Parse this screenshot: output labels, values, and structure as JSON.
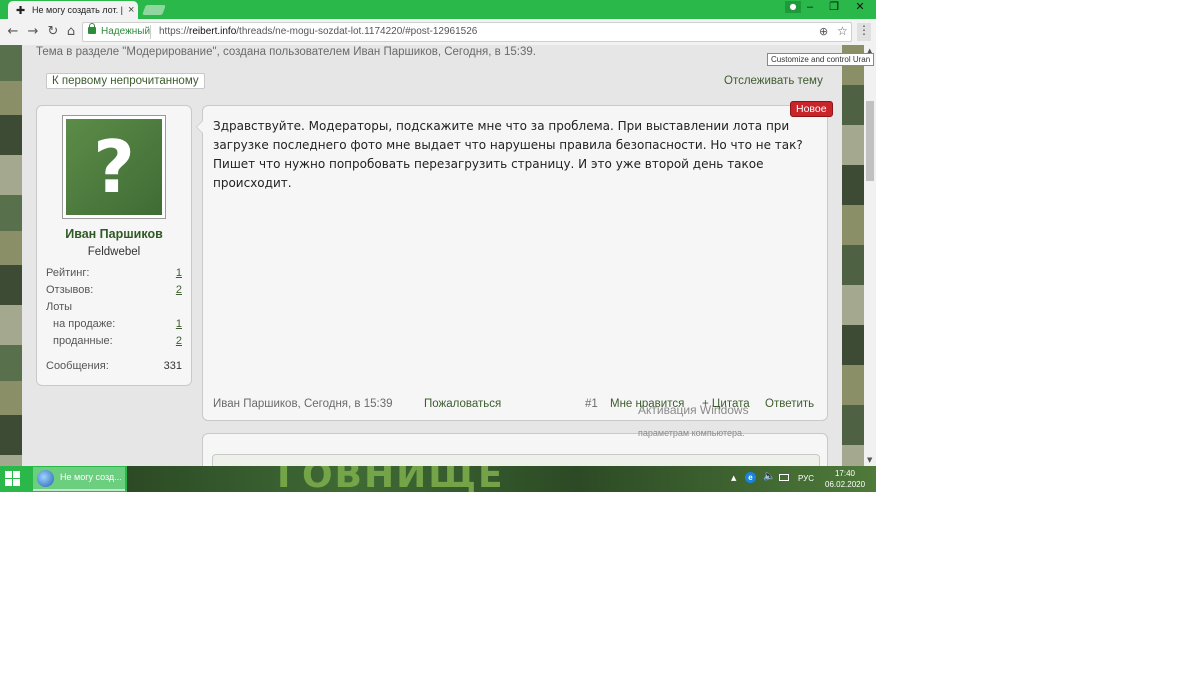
{
  "browser": {
    "tab_favicon": "✚",
    "tab_title": "Не могу создать лот. | R",
    "tab_close": "×",
    "window_min": "–",
    "window_max": "❐",
    "window_close": "✕",
    "secure_label": "Надежный",
    "url_scheme": "https://",
    "url_host": "reibert.info",
    "url_path": "/threads/ne-mogu-sozdat-lot.1174220/#post-12961526",
    "tooltip": "Customize and control Uran",
    "icons": {
      "back": "←",
      "forward": "→",
      "reload": "↻",
      "home": "⌂",
      "zoom": "⊕",
      "star": "☆",
      "menu": "⋮",
      "profile": "●"
    }
  },
  "thread": {
    "description": "Тема в разделе \"Модерирование\", создана пользователем Иван Паршиков, Сегодня, в 15:39.",
    "first_unread_label": "К первому непрочитанному",
    "watch_label": "Отслеживать тему"
  },
  "user": {
    "name": "Иван Паршиков",
    "title": "Feldwebel",
    "avatar_glyph": "?",
    "stats": {
      "rating_label": "Рейтинг:",
      "rating_value": "1",
      "reviews_label": "Отзывов:",
      "reviews_value": "2",
      "lots_label": "Лоты",
      "on_sale_label": "на продаже:",
      "on_sale_value": "1",
      "sold_label": "проданные:",
      "sold_value": "2",
      "messages_label": "Сообщения:",
      "messages_value": "331"
    }
  },
  "post": {
    "badge": "Новое",
    "body": "Здравствуйте. Модераторы, подскажите мне что за проблема. При выставлении лота при загрузке последнего фото мне выдает что нарушены правила безопасности. Но что не так? Пишет что нужно попробовать перезагрузить страницу. И это уже второй день такое происходит.",
    "author_time": "Иван Паршиков, Сегодня, в 15:39",
    "report_label": "Пожаловаться",
    "number": "#1",
    "like_label": "Мне нравится",
    "quote_label": "+ Цитата",
    "reply_label": "Ответить"
  },
  "activation": {
    "title": "Активация Windows",
    "subtitle": "параметрам компьютера."
  },
  "taskbar": {
    "task_label": "Не могу созд...",
    "banner_text": "ГОВНИЩЕ",
    "tray_lang": "РУС",
    "tray_time": "17:40",
    "tray_date": "06.02.2020",
    "tray_up_icon": "▲",
    "tray_edge_icon": "e",
    "tray_volume_icon": "🔈"
  },
  "colors": {
    "chrome_green": "#2bb84a",
    "link_green": "#3d5c2f",
    "badge_red": "#c8242a",
    "panel_bg": "#f6f6f6"
  }
}
